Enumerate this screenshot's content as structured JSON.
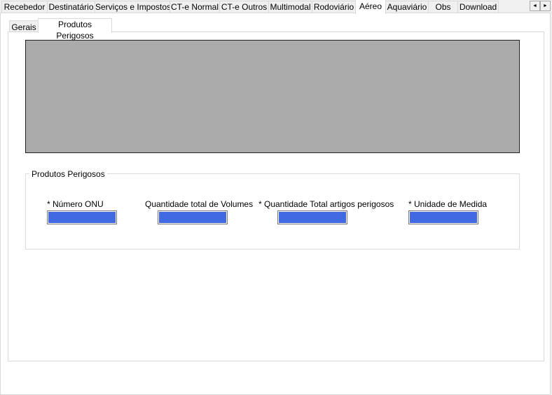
{
  "tabs": [
    {
      "label": "Recebedor"
    },
    {
      "label": "Destinatário"
    },
    {
      "label": "Serviços e Impostos"
    },
    {
      "label": "CT-e Normal"
    },
    {
      "label": "CT-e Outros"
    },
    {
      "label": "Multimodal"
    },
    {
      "label": "Rodoviário"
    },
    {
      "label": "Aéreo",
      "selected": true
    },
    {
      "label": "Aquaviário"
    },
    {
      "label": "Obs"
    },
    {
      "label": "Download"
    }
  ],
  "scroll": {
    "left": "◄",
    "right": "►"
  },
  "subtabs": [
    {
      "label": "Gerais"
    },
    {
      "label": "Produtos Perigosos",
      "selected": true
    }
  ],
  "group": {
    "title": "Produtos Perigosos",
    "fields": [
      {
        "label": "* Número ONU",
        "value": ""
      },
      {
        "label": "Quantidade total de Volumes",
        "value": ""
      },
      {
        "label": "* Quantidade Total artigos perigosos",
        "value": ""
      },
      {
        "label": "* Unidade de Medida",
        "value": ""
      }
    ]
  },
  "colors": {
    "input_bg": "#4169e1",
    "grid_bg": "#ababab"
  }
}
